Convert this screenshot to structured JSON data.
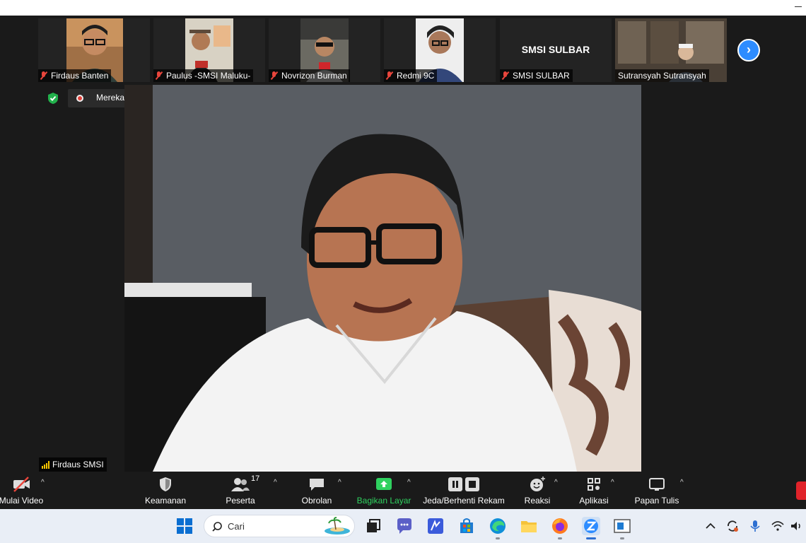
{
  "participants": [
    {
      "name": "Firdaus Banten",
      "muted": true
    },
    {
      "name": "Paulus -SMSI Maluku-",
      "muted": true
    },
    {
      "name": "Novrizon Burman",
      "muted": true
    },
    {
      "name": "Redmi 9C",
      "muted": true
    },
    {
      "name": "SMSI SULBAR",
      "muted": true,
      "display_text": "SMSI SULBAR"
    },
    {
      "name": "Sutransyah Sutransyah",
      "muted": false
    }
  ],
  "recording": {
    "status_text": "Merekam..."
  },
  "speaker": {
    "name": "Firdaus SMSI"
  },
  "toolbar": {
    "video_label": "Mulai Video",
    "security_label": "Keamanan",
    "participants_label": "Peserta",
    "participants_count": "17",
    "chat_label": "Obrolan",
    "share_label": "Bagikan Layar",
    "record_label": "Jeda/Berhenti Rekam",
    "reactions_label": "Reaksi",
    "apps_label": "Aplikasi",
    "whiteboard_label": "Papan Tulis"
  },
  "taskbar": {
    "search_placeholder": "Cari"
  },
  "colors": {
    "share_green": "#2fd15f",
    "muted_red": "#e8453c",
    "accent_blue": "#2d8cff",
    "signal_yellow": "#f7c500"
  },
  "icons": [
    "windows-start-icon",
    "search-icon",
    "task-view-icon",
    "teams-chat-icon",
    "app-icon",
    "store-icon",
    "edge-icon",
    "file-explorer-icon",
    "firefox-icon",
    "zoom-icon",
    "app-window-icon",
    "chevron-up-icon",
    "sync-icon",
    "microphone-icon",
    "wifi-icon",
    "speaker-icon"
  ]
}
